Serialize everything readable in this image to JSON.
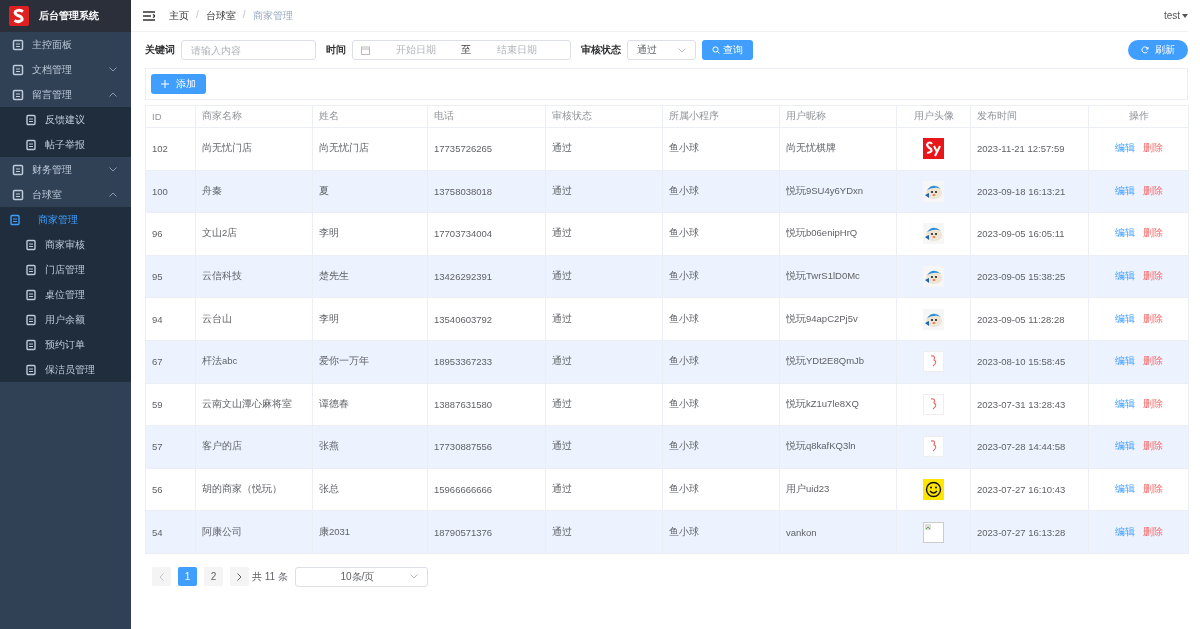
{
  "app": {
    "title": "后台管理系统"
  },
  "sidebar": {
    "items": [
      {
        "label": "主控面板",
        "selected": false
      },
      {
        "label": "文档管理",
        "expanded": false
      },
      {
        "label": "留言管理",
        "expanded": true,
        "children": [
          {
            "label": "反馈建议",
            "selected": false
          },
          {
            "label": "帖子举报",
            "selected": false
          }
        ]
      },
      {
        "label": "财务管理",
        "expanded": false
      },
      {
        "label": "台球室",
        "expanded": true,
        "children": [
          {
            "label": "商家管理",
            "selected": true
          },
          {
            "label": "商家审核",
            "selected": false
          },
          {
            "label": "门店管理",
            "selected": false
          },
          {
            "label": "桌位管理",
            "selected": false
          },
          {
            "label": "用户余额",
            "selected": false
          },
          {
            "label": "预约订单",
            "selected": false
          },
          {
            "label": "保洁员管理",
            "selected": false
          }
        ]
      }
    ]
  },
  "header": {
    "breadcrumb": [
      {
        "kind": "link",
        "text": "主页"
      },
      {
        "kind": "separator",
        "text": "/"
      },
      {
        "kind": "link",
        "text": "台球室"
      },
      {
        "kind": "separator",
        "text": "/"
      },
      {
        "kind": "current",
        "text": "商家管理"
      }
    ],
    "user": "test"
  },
  "filters": {
    "keyword_label": "关键词",
    "keyword_placeholder": "请输入内容",
    "time_label": "时间",
    "start_placeholder": "开始日期",
    "range_separator": "至",
    "end_placeholder": "结束日期",
    "status_label": "审核状态",
    "status_value": "通过",
    "search_button": "查询",
    "refresh_button": "刷新"
  },
  "toolbar": {
    "add_button": "添加"
  },
  "table": {
    "columns": [
      "ID",
      "商家名称",
      "姓名",
      "电话",
      "审核状态",
      "所属小程序",
      "用户昵称",
      "用户头像",
      "发布时间",
      "操作"
    ],
    "rows": [
      {
        "id": "102",
        "name": "尚无忧门店",
        "person": "尚无忧门店",
        "phone": "17735726265",
        "status": "通过",
        "program": "鱼小球",
        "nickname": "尚无忧棋牌",
        "time": "2023-11-21 12:57:59",
        "actions": [
          "编辑",
          "删除"
        ]
      },
      {
        "id": "100",
        "name": "舟秦",
        "person": "夏",
        "phone": "13758038018",
        "status": "通过",
        "program": "鱼小球",
        "nickname": "悦玩9SU4y6YDxn",
        "time": "2023-09-18 16:13:21",
        "actions": [
          "编辑",
          "删除"
        ]
      },
      {
        "id": "96",
        "name": "文山2店",
        "person": "李明",
        "phone": "17703734004",
        "status": "通过",
        "program": "鱼小球",
        "nickname": "悦玩b06enipHrQ",
        "time": "2023-09-05 16:05:11",
        "actions": [
          "编辑",
          "删除"
        ]
      },
      {
        "id": "95",
        "name": "云信科技",
        "person": "楚先生",
        "phone": "13426292391",
        "status": "通过",
        "program": "鱼小球",
        "nickname": "悦玩TwrS1lD0Mc",
        "time": "2023-09-05 15:38:25",
        "actions": [
          "编辑",
          "删除"
        ]
      },
      {
        "id": "94",
        "name": "云台山",
        "person": "李明",
        "phone": "13540603792",
        "status": "通过",
        "program": "鱼小球",
        "nickname": "悦玩94apC2Pj5v",
        "time": "2023-09-05 11:28:28",
        "actions": [
          "编辑",
          "删除"
        ]
      },
      {
        "id": "67",
        "name": "杆法abc",
        "person": "爱你一万年",
        "phone": "18953367233",
        "status": "通过",
        "program": "鱼小球",
        "nickname": "悦玩YDt2E8QmJb",
        "time": "2023-08-10 15:58:45",
        "actions": [
          "编辑",
          "删除"
        ]
      },
      {
        "id": "59",
        "name": "云南文山潭心麻将室",
        "person": "谭德春",
        "phone": "13887631580",
        "status": "通过",
        "program": "鱼小球",
        "nickname": "悦玩kZ1u7le8XQ",
        "time": "2023-07-31 13:28:43",
        "actions": [
          "编辑",
          "删除"
        ]
      },
      {
        "id": "57",
        "name": "客户的店",
        "person": "张燕",
        "phone": "17730887556",
        "status": "通过",
        "program": "鱼小球",
        "nickname": "悦玩q8kafKQ3ln",
        "time": "2023-07-28 14:44:58",
        "actions": [
          "编辑",
          "删除"
        ]
      },
      {
        "id": "56",
        "name": "胡的商家（悦玩）",
        "person": "张总",
        "phone": "15966666666",
        "status": "通过",
        "program": "鱼小球",
        "nickname": "用户uid23",
        "time": "2023-07-27 16:10:43",
        "actions": [
          "编辑",
          "删除"
        ]
      },
      {
        "id": "54",
        "name": "阿康公司",
        "person": "康2031",
        "phone": "18790571376",
        "status": "通过",
        "program": "鱼小球",
        "nickname": "vankon",
        "avatar": {
          "kind": "broken_image"
        },
        "time": "2023-07-27 16:13:28",
        "actions": [
          "编辑",
          "删除"
        ]
      }
    ]
  },
  "pagination": {
    "prev_disabled": true,
    "pages": [
      {
        "label": "1",
        "selected": true
      },
      {
        "label": "2",
        "selected": false
      }
    ],
    "total": "共 11 条",
    "page_size": "10条/页"
  }
}
